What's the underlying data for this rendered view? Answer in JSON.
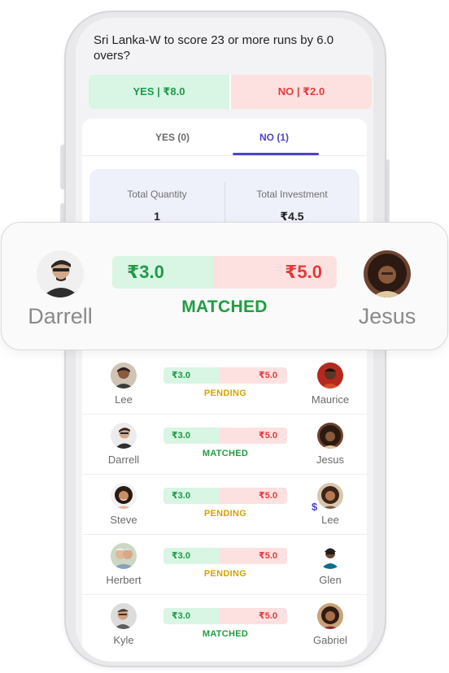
{
  "question": {
    "text": "Sri Lanka-W to score 23 or more runs by 6.0 overs?",
    "yes_label": "YES | ₹8.0",
    "no_label": "NO | ₹2.0"
  },
  "tabs": [
    {
      "label": "YES (0)",
      "active": false
    },
    {
      "label": "NO (1)",
      "active": true
    }
  ],
  "summary": {
    "quantity_label": "Total Quantity",
    "quantity_value": "1",
    "investment_label": "Total Investment",
    "investment_value": "₹4.5"
  },
  "match_card": {
    "left_name": "Darrell",
    "right_name": "Jesus",
    "yes_price": "₹3.0",
    "no_price": "₹5.0",
    "status": "MATCHED"
  },
  "rows": [
    {
      "left_name": "Lee",
      "right_name": "Maurice",
      "yes_price": "₹3.0",
      "no_price": "₹5.0",
      "status": "PENDING"
    },
    {
      "left_name": "Darrell",
      "right_name": "Jesus",
      "yes_price": "₹3.0",
      "no_price": "₹5.0",
      "status": "MATCHED"
    },
    {
      "left_name": "Steve",
      "right_name": "Lee",
      "yes_price": "₹3.0",
      "no_price": "₹5.0",
      "status": "PENDING",
      "right_badge": "$"
    },
    {
      "left_name": "Herbert",
      "right_name": "Glen",
      "yes_price": "₹3.0",
      "no_price": "₹5.0",
      "status": "PENDING"
    },
    {
      "left_name": "Kyle",
      "right_name": "Gabriel",
      "yes_price": "₹3.0",
      "no_price": "₹5.0",
      "status": "MATCHED"
    }
  ],
  "colors": {
    "yes_bg": "#d9f5e3",
    "yes_text": "#1f9a4a",
    "no_bg": "#fde1e1",
    "no_text": "#e23b3b",
    "accent": "#4f44c8",
    "pending": "#d6a300",
    "matched": "#1e9e40"
  }
}
